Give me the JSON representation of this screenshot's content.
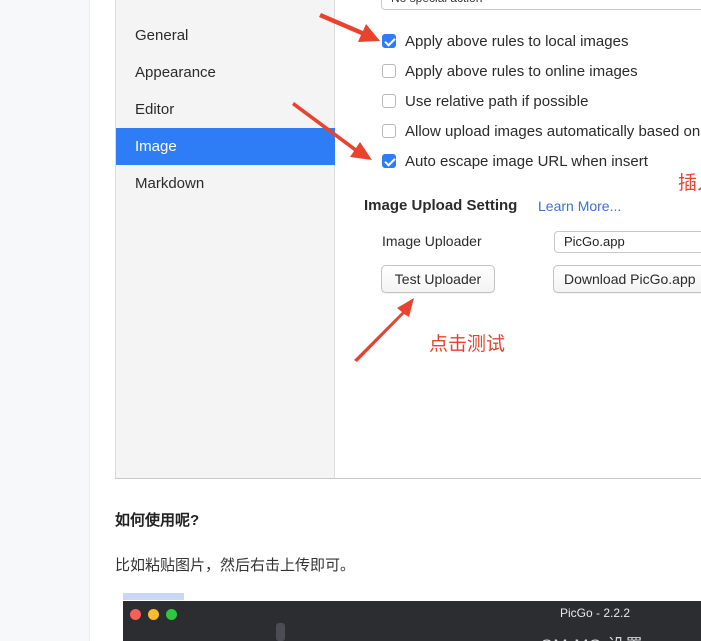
{
  "prefs": {
    "top_select_value": "No special action",
    "sidebar": [
      {
        "label": "General"
      },
      {
        "label": "Appearance"
      },
      {
        "label": "Editor"
      },
      {
        "label": "Image",
        "active": true
      },
      {
        "label": "Markdown"
      }
    ],
    "checkboxes": [
      {
        "label": "Apply above rules to local images",
        "checked": true
      },
      {
        "label": "Apply above rules to online images",
        "checked": false
      },
      {
        "label": "Use relative path if possible",
        "checked": false
      },
      {
        "label": "Allow upload images automatically based on",
        "checked": false
      },
      {
        "label": "Auto escape image URL when insert",
        "checked": true
      }
    ],
    "upload_section": {
      "title": "Image Upload Setting",
      "learn_more": "Learn More...",
      "uploader_label": "Image Uploader",
      "uploader_value": "PicGo.app",
      "test_button": "Test Uploader",
      "download_button": "Download PicGo.app"
    },
    "annotations": {
      "right_text": "插入",
      "test_text": "点击测试"
    }
  },
  "article": {
    "question": "如何使用呢?",
    "paragraph": "比如粘贴图片，然后右击上传即可。"
  },
  "picgo_window": {
    "title": "PicGo - 2.2.2",
    "subtitle": "SM.MS 设置"
  },
  "colors": {
    "accent_blue": "#2e7cf6",
    "annotation_red": "#e9432f",
    "link_blue": "#3a73c8"
  }
}
